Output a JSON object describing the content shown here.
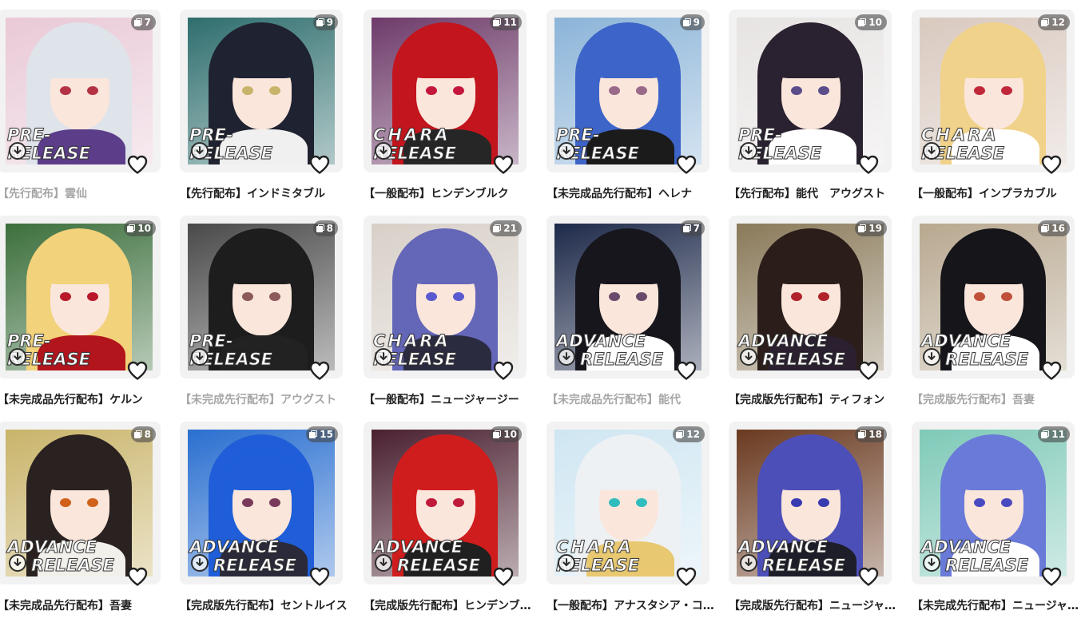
{
  "colors": {
    "card_bg": "#f2f2f2",
    "badge_bg": "#6b6b6b",
    "title_text": "#222222",
    "title_muted": "#a6a6a6",
    "release_text_fill": "#ffffff",
    "release_text_outline": "#3d3d3d"
  },
  "cards": [
    {
      "count": "7",
      "release_line1": "PRE-",
      "release_line2": "RELEASE",
      "release_style": "pre",
      "title": "【先行配布】雲仙",
      "muted": true,
      "bg": "#e9c9d6",
      "hair": "#dfe3ea",
      "eyes": "#b33344",
      "outfit": "#5c3d8a"
    },
    {
      "count": "9",
      "release_line1": "PRE-",
      "release_line2": "RELEASE",
      "release_style": "pre",
      "title": "【先行配布】インドミタブル",
      "muted": false,
      "bg": "#2f6e6e",
      "hair": "#1f2230",
      "eyes": "#c8b36a",
      "outfit": "#f0f0f0"
    },
    {
      "count": "11",
      "release_line1": "CHARA",
      "release_line2": "RELEASE",
      "release_style": "chara",
      "title": "【一般配布】ヒンデンブルク",
      "muted": false,
      "bg": "#6e3b6a",
      "hair": "#c2151d",
      "eyes": "#c4163a",
      "outfit": "#262626"
    },
    {
      "count": "9",
      "release_line1": "PRE-",
      "release_line2": "RELEASE",
      "release_style": "pre",
      "title": "【未完成品先行配布】ヘレナ",
      "muted": false,
      "bg": "#8bb4d8",
      "hair": "#3d64c8",
      "eyes": "#9a6a8a",
      "outfit": "#1b1b1b"
    },
    {
      "count": "10",
      "release_line1": "PRE-",
      "release_line2": "RELEASE",
      "release_style": "pre",
      "title": "【先行配布】能代　アウグスト",
      "muted": false,
      "bg": "#e7e3e3",
      "hair": "#2a2230",
      "eyes": "#5b4c8a",
      "outfit": "#ffffff"
    },
    {
      "count": "12",
      "release_line1": "CHARA",
      "release_line2": "RELEASE",
      "release_style": "chara",
      "title": "【一般配布】インプラカブル",
      "muted": false,
      "bg": "#d9c9bf",
      "hair": "#f0d28a",
      "eyes": "#c0283a",
      "outfit": "#ffffff"
    },
    {
      "count": "10",
      "release_line1": "PRE-",
      "release_line2": "RELEASE",
      "release_style": "pre",
      "title": "【未完成品先行配布】ケルン",
      "muted": false,
      "bg": "#3c6f3c",
      "hair": "#f2d27a",
      "eyes": "#b8182a",
      "outfit": "#b3151d"
    },
    {
      "count": "8",
      "release_line1": "PRE-",
      "release_line2": "RELEASE",
      "release_style": "pre",
      "title": "【未完成先行配布】アウグスト",
      "muted": true,
      "bg": "#4a4a4a",
      "hair": "#1d1d1d",
      "eyes": "#8c5a5a",
      "outfit": "#222222"
    },
    {
      "count": "21",
      "release_line1": "CHARA",
      "release_line2": "RELEASE",
      "release_style": "chara",
      "title": "【一般配布】ニュージャージー",
      "muted": false,
      "bg": "#d8d0c8",
      "hair": "#6466b8",
      "eyes": "#5a5ad0",
      "outfit": "#2b2b40"
    },
    {
      "count": "7",
      "release_line1": "ADVANCE",
      "release_line2": "RELEASE",
      "release_style": "adv",
      "title": "【未完成品先行配布】能代",
      "muted": true,
      "bg": "#1e2a4a",
      "hair": "#16161c",
      "eyes": "#6a4a6a",
      "outfit": "#ffffff"
    },
    {
      "count": "19",
      "release_line1": "ADVANCE",
      "release_line2": "RELEASE",
      "release_style": "adv",
      "title": "【完成版先行配布】ティフォン",
      "muted": false,
      "bg": "#8a7a5a",
      "hair": "#2b1e1a",
      "eyes": "#b0222a",
      "outfit": "#2a2030"
    },
    {
      "count": "16",
      "release_line1": "ADVANCE",
      "release_line2": "RELEASE",
      "release_style": "adv",
      "title": "【完成版先行配布】吾妻",
      "muted": true,
      "bg": "#b8a890",
      "hair": "#15151a",
      "eyes": "#c0503a",
      "outfit": "#ffffff"
    },
    {
      "count": "8",
      "release_line1": "ADVANCE",
      "release_line2": "RELEASE",
      "release_style": "adv",
      "title": "【未完成品先行配布】吾妻",
      "muted": false,
      "bg": "#c9b46a",
      "hair": "#2a2220",
      "eyes": "#d0601a",
      "outfit": "#f2f0ea"
    },
    {
      "count": "15",
      "release_line1": "ADVANCE",
      "release_line2": "RELEASE",
      "release_style": "adv",
      "title": "【完成版先行配布】セントルイス",
      "muted": false,
      "bg": "#2a6fd0",
      "hair": "#1f5ed8",
      "eyes": "#7a3a5a",
      "outfit": "#2a2a3a"
    },
    {
      "count": "10",
      "release_line1": "ADVANCE",
      "release_line2": "RELEASE",
      "release_style": "adv",
      "title": "【完成版先行配布】ヒンデンブルク",
      "muted": false,
      "bg": "#4a2030",
      "hair": "#cf1d1d",
      "eyes": "#c01a3a",
      "outfit": "#202020"
    },
    {
      "count": "12",
      "release_line1": "CHARA",
      "release_line2": "RELEASE",
      "release_style": "chara",
      "title": "【一般配布】アナスタシア・コーヴァ",
      "muted": false,
      "bg": "#cfe6f2",
      "hair": "#eef1f4",
      "eyes": "#2fbdbd",
      "outfit": "#e8c870"
    },
    {
      "count": "18",
      "release_line1": "ADVANCE",
      "release_line2": "RELEASE",
      "release_style": "adv",
      "title": "【完成版先行配布】ニュージャージー",
      "muted": false,
      "bg": "#6a3a20",
      "hair": "#4d4fb8",
      "eyes": "#3a3ab0",
      "outfit": "#1e1e2a"
    },
    {
      "count": "11",
      "release_line1": "ADVANCE",
      "release_line2": "RELEASE",
      "release_style": "adv",
      "title": "【未完成先行配布】ニュージャージー",
      "muted": false,
      "bg": "#7fc9b8",
      "hair": "#6a7ad8",
      "eyes": "#4a4ac0",
      "outfit": "#ffffff"
    }
  ]
}
